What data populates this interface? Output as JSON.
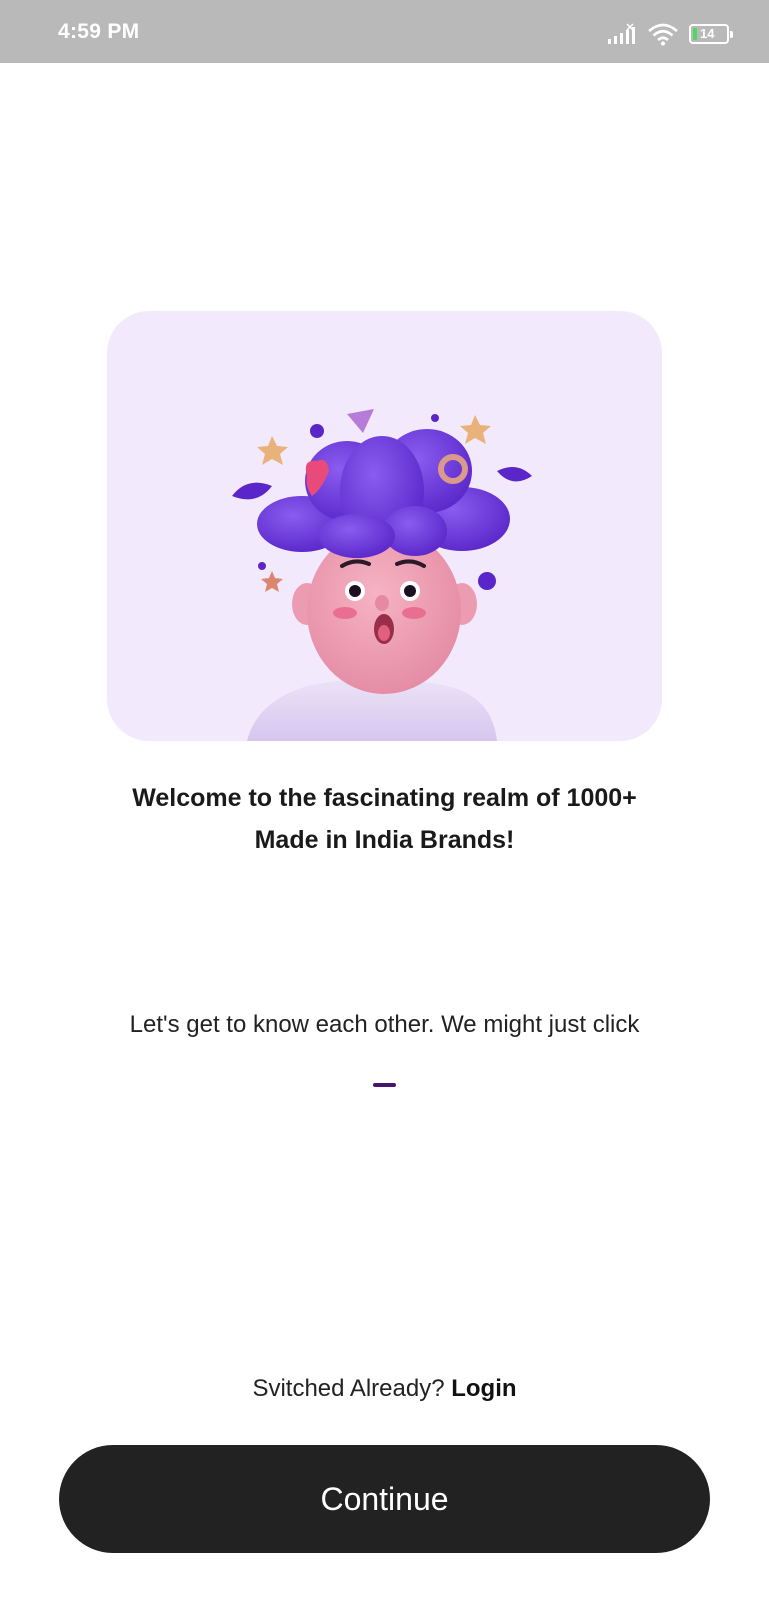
{
  "status_bar": {
    "time": "4:59 PM",
    "battery_level": "14",
    "icons": [
      "signal-icon",
      "wifi-icon",
      "battery-icon"
    ]
  },
  "hero": {
    "illustration": "surprised-character-illustration",
    "background_color": "#f2eafc"
  },
  "welcome": {
    "title_line1": "Welcome to the fascinating realm of 1000+",
    "title_line2": "Made in India Brands!"
  },
  "onboarding": {
    "subtitle": "Let's get to know each other. We might just click",
    "current_page": 1
  },
  "login_prompt": {
    "text": "Svitched Already? ",
    "link_label": "Login"
  },
  "continue_button": {
    "label": "Continue",
    "color": "#222222"
  },
  "accent_color": "#4a1570"
}
